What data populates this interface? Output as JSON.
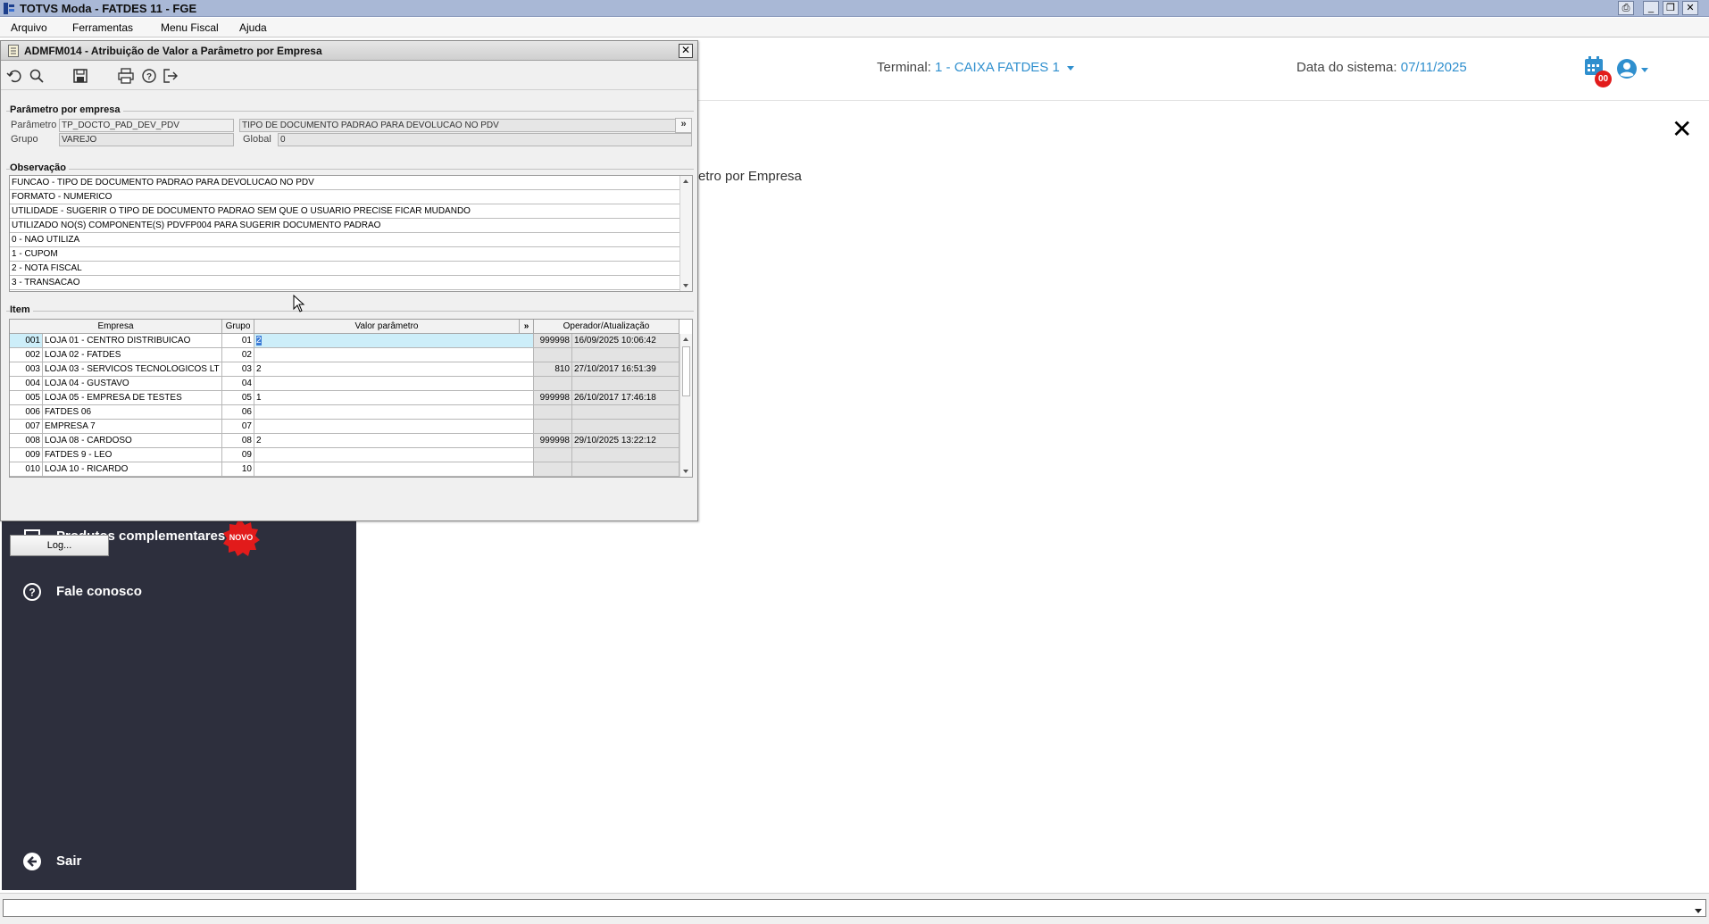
{
  "window": {
    "title": "TOTVS Moda - FATDES 11 - FGE"
  },
  "menu": [
    {
      "label": "Arquivo"
    },
    {
      "label": "Ferramentas"
    },
    {
      "label": "Menu Fiscal"
    },
    {
      "label": "Ajuda"
    }
  ],
  "header": {
    "terminal_label": "Terminal:",
    "terminal_value": "1 - CAIXA FATDES 1",
    "date_label": "Data do sistema:",
    "date_value": "07/11/2025",
    "notif_count": "00"
  },
  "content": {
    "breadcrumb_fragment": "etro por Empresa",
    "close_glyph": "✕"
  },
  "sidebar": {
    "items": [
      {
        "label": "Produtos complementares",
        "icon": "laptop-icon",
        "badge": "NOVO"
      },
      {
        "label": "Fale conosco",
        "icon": "help-circle-icon"
      },
      {
        "label": "Sair",
        "icon": "arrow-left-circle-icon"
      }
    ]
  },
  "dialog": {
    "title": "ADMFM014 - Atribuição de Valor a Parâmetro por Empresa",
    "close_glyph": "✕",
    "toolbar": [
      "undo-icon",
      "search-icon",
      "save-icon",
      "print-icon",
      "help-icon",
      "exit-icon"
    ],
    "param_group": {
      "title": "Parâmetro por empresa",
      "parametro_label": "Parâmetro",
      "parametro_value": "TP_DOCTO_PAD_DEV_PDV",
      "parametro_desc": "TIPO DE DOCUMENTO PADRAO PARA DEVOLUCAO NO PDV",
      "expand_glyph": "»",
      "grupo_label": "Grupo",
      "grupo_value": "VAREJO",
      "global_label": "Global",
      "global_value": "0"
    },
    "observacao": {
      "title": "Observação",
      "lines": [
        "FUNCAO - TIPO DE DOCUMENTO PADRAO PARA DEVOLUCAO NO PDV",
        "FORMATO - NUMERICO",
        "UTILIDADE - SUGERIR O TIPO DE DOCUMENTO PADRAO SEM QUE O USUARIO PRECISE FICAR MUDANDO",
        "UTILIZADO NO(S) COMPONENTE(S) PDVFP004 PARA SUGERIR DOCUMENTO PADRAO",
        "0 - NAO UTILIZA",
        "1 - CUPOM",
        "2 - NOTA FISCAL",
        "3 - TRANSACAO"
      ]
    },
    "item": {
      "title": "Item",
      "headers": {
        "empresa": "Empresa",
        "grupo": "Grupo",
        "valor": "Valor parâmetro",
        "expand": "»",
        "operador": "Operador/Atualização"
      },
      "rows": [
        {
          "code": "001",
          "name": "LOJA 01 - CENTRO DISTRIBUICAO",
          "grupo": "01",
          "valor": "2",
          "operador": "999998",
          "data": "16/09/2025 10:06:42"
        },
        {
          "code": "002",
          "name": "LOJA 02 - FATDES",
          "grupo": "02",
          "valor": "",
          "operador": "",
          "data": ""
        },
        {
          "code": "003",
          "name": "LOJA 03 - SERVICOS TECNOLOGICOS LT",
          "grupo": "03",
          "valor": "2",
          "operador": "810",
          "data": "27/10/2017 16:51:39"
        },
        {
          "code": "004",
          "name": "LOJA 04 - GUSTAVO",
          "grupo": "04",
          "valor": "",
          "operador": "",
          "data": ""
        },
        {
          "code": "005",
          "name": "LOJA 05 - EMPRESA DE TESTES",
          "grupo": "05",
          "valor": "1",
          "operador": "999998",
          "data": "26/10/2017 17:46:18"
        },
        {
          "code": "006",
          "name": "FATDES 06",
          "grupo": "06",
          "valor": "",
          "operador": "",
          "data": ""
        },
        {
          "code": "007",
          "name": "EMPRESA 7",
          "grupo": "07",
          "valor": "",
          "operador": "",
          "data": ""
        },
        {
          "code": "008",
          "name": "LOJA 08 - CARDOSO",
          "grupo": "08",
          "valor": "2",
          "operador": "999998",
          "data": "29/10/2025 13:22:12"
        },
        {
          "code": "009",
          "name": "FATDES 9 - LEO",
          "grupo": "09",
          "valor": "",
          "operador": "",
          "data": ""
        },
        {
          "code": "010",
          "name": "LOJA 10 - RICARDO",
          "grupo": "10",
          "valor": "",
          "operador": "",
          "data": ""
        }
      ]
    },
    "log_button": "Log..."
  },
  "colors": {
    "accent": "#2f8fce",
    "sidebar_bg": "#2d2f3d",
    "badge_red": "#e21b1b",
    "selection": "#cdeef9"
  }
}
